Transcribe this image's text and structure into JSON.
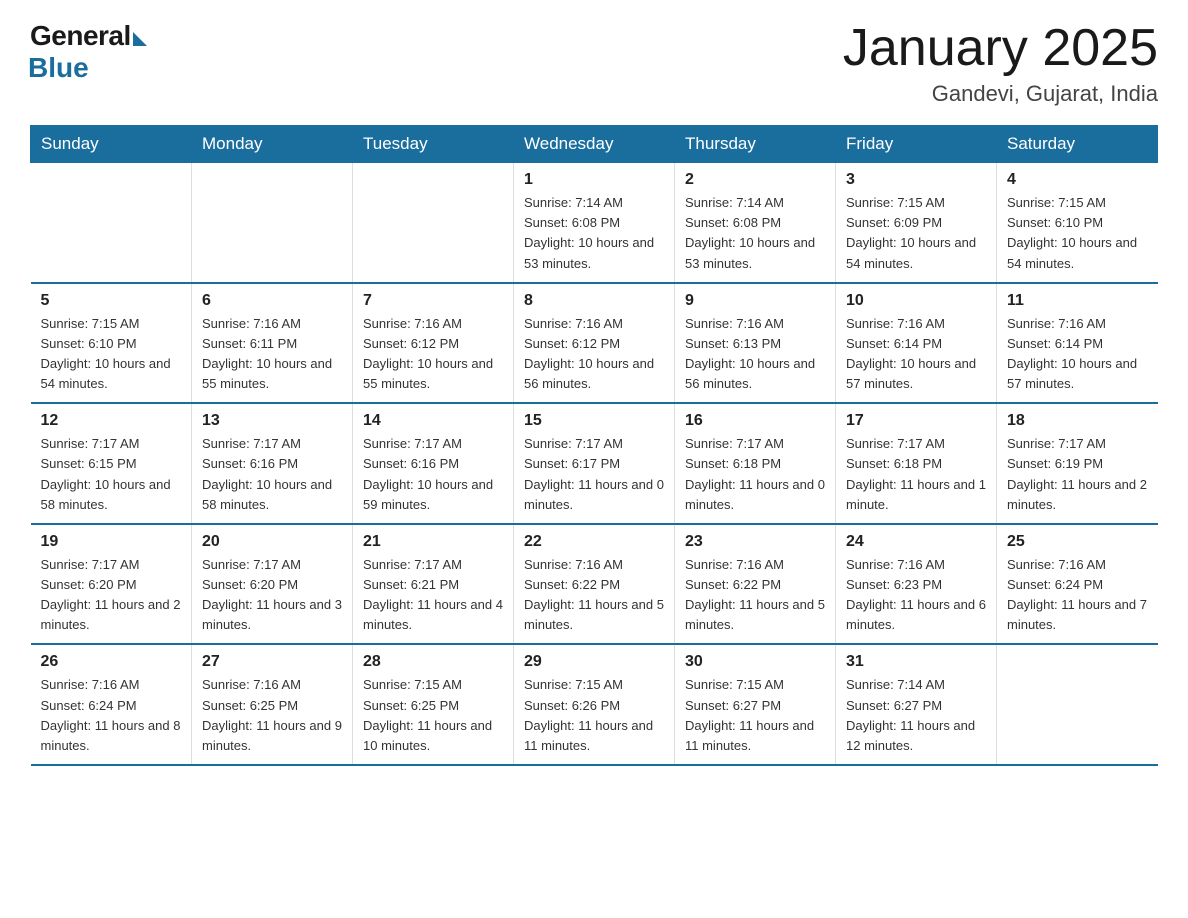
{
  "header": {
    "logo_general": "General",
    "logo_blue": "Blue",
    "title": "January 2025",
    "subtitle": "Gandevi, Gujarat, India"
  },
  "days_of_week": [
    "Sunday",
    "Monday",
    "Tuesday",
    "Wednesday",
    "Thursday",
    "Friday",
    "Saturday"
  ],
  "weeks": [
    [
      {
        "day": "",
        "info": ""
      },
      {
        "day": "",
        "info": ""
      },
      {
        "day": "",
        "info": ""
      },
      {
        "day": "1",
        "info": "Sunrise: 7:14 AM\nSunset: 6:08 PM\nDaylight: 10 hours\nand 53 minutes."
      },
      {
        "day": "2",
        "info": "Sunrise: 7:14 AM\nSunset: 6:08 PM\nDaylight: 10 hours\nand 53 minutes."
      },
      {
        "day": "3",
        "info": "Sunrise: 7:15 AM\nSunset: 6:09 PM\nDaylight: 10 hours\nand 54 minutes."
      },
      {
        "day": "4",
        "info": "Sunrise: 7:15 AM\nSunset: 6:10 PM\nDaylight: 10 hours\nand 54 minutes."
      }
    ],
    [
      {
        "day": "5",
        "info": "Sunrise: 7:15 AM\nSunset: 6:10 PM\nDaylight: 10 hours\nand 54 minutes."
      },
      {
        "day": "6",
        "info": "Sunrise: 7:16 AM\nSunset: 6:11 PM\nDaylight: 10 hours\nand 55 minutes."
      },
      {
        "day": "7",
        "info": "Sunrise: 7:16 AM\nSunset: 6:12 PM\nDaylight: 10 hours\nand 55 minutes."
      },
      {
        "day": "8",
        "info": "Sunrise: 7:16 AM\nSunset: 6:12 PM\nDaylight: 10 hours\nand 56 minutes."
      },
      {
        "day": "9",
        "info": "Sunrise: 7:16 AM\nSunset: 6:13 PM\nDaylight: 10 hours\nand 56 minutes."
      },
      {
        "day": "10",
        "info": "Sunrise: 7:16 AM\nSunset: 6:14 PM\nDaylight: 10 hours\nand 57 minutes."
      },
      {
        "day": "11",
        "info": "Sunrise: 7:16 AM\nSunset: 6:14 PM\nDaylight: 10 hours\nand 57 minutes."
      }
    ],
    [
      {
        "day": "12",
        "info": "Sunrise: 7:17 AM\nSunset: 6:15 PM\nDaylight: 10 hours\nand 58 minutes."
      },
      {
        "day": "13",
        "info": "Sunrise: 7:17 AM\nSunset: 6:16 PM\nDaylight: 10 hours\nand 58 minutes."
      },
      {
        "day": "14",
        "info": "Sunrise: 7:17 AM\nSunset: 6:16 PM\nDaylight: 10 hours\nand 59 minutes."
      },
      {
        "day": "15",
        "info": "Sunrise: 7:17 AM\nSunset: 6:17 PM\nDaylight: 11 hours\nand 0 minutes."
      },
      {
        "day": "16",
        "info": "Sunrise: 7:17 AM\nSunset: 6:18 PM\nDaylight: 11 hours\nand 0 minutes."
      },
      {
        "day": "17",
        "info": "Sunrise: 7:17 AM\nSunset: 6:18 PM\nDaylight: 11 hours\nand 1 minute."
      },
      {
        "day": "18",
        "info": "Sunrise: 7:17 AM\nSunset: 6:19 PM\nDaylight: 11 hours\nand 2 minutes."
      }
    ],
    [
      {
        "day": "19",
        "info": "Sunrise: 7:17 AM\nSunset: 6:20 PM\nDaylight: 11 hours\nand 2 minutes."
      },
      {
        "day": "20",
        "info": "Sunrise: 7:17 AM\nSunset: 6:20 PM\nDaylight: 11 hours\nand 3 minutes."
      },
      {
        "day": "21",
        "info": "Sunrise: 7:17 AM\nSunset: 6:21 PM\nDaylight: 11 hours\nand 4 minutes."
      },
      {
        "day": "22",
        "info": "Sunrise: 7:16 AM\nSunset: 6:22 PM\nDaylight: 11 hours\nand 5 minutes."
      },
      {
        "day": "23",
        "info": "Sunrise: 7:16 AM\nSunset: 6:22 PM\nDaylight: 11 hours\nand 5 minutes."
      },
      {
        "day": "24",
        "info": "Sunrise: 7:16 AM\nSunset: 6:23 PM\nDaylight: 11 hours\nand 6 minutes."
      },
      {
        "day": "25",
        "info": "Sunrise: 7:16 AM\nSunset: 6:24 PM\nDaylight: 11 hours\nand 7 minutes."
      }
    ],
    [
      {
        "day": "26",
        "info": "Sunrise: 7:16 AM\nSunset: 6:24 PM\nDaylight: 11 hours\nand 8 minutes."
      },
      {
        "day": "27",
        "info": "Sunrise: 7:16 AM\nSunset: 6:25 PM\nDaylight: 11 hours\nand 9 minutes."
      },
      {
        "day": "28",
        "info": "Sunrise: 7:15 AM\nSunset: 6:25 PM\nDaylight: 11 hours\nand 10 minutes."
      },
      {
        "day": "29",
        "info": "Sunrise: 7:15 AM\nSunset: 6:26 PM\nDaylight: 11 hours\nand 11 minutes."
      },
      {
        "day": "30",
        "info": "Sunrise: 7:15 AM\nSunset: 6:27 PM\nDaylight: 11 hours\nand 11 minutes."
      },
      {
        "day": "31",
        "info": "Sunrise: 7:14 AM\nSunset: 6:27 PM\nDaylight: 11 hours\nand 12 minutes."
      },
      {
        "day": "",
        "info": ""
      }
    ]
  ]
}
